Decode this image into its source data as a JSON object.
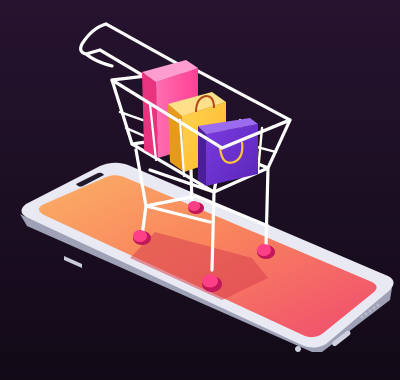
{
  "scene": {
    "subject": "shopping-cart-on-smartphone",
    "colors": {
      "background_top": "#24122e",
      "background_bottom": "#120a18",
      "screen_light": "#f9a35a",
      "screen_dark": "#f0566a",
      "phone_frame": "#e6e7f2",
      "phone_side": "#b9bccd",
      "cart_wire": "#ffffff",
      "wheels": "#e0216a",
      "pink_box": "#ff5fa8",
      "yellow_bag": "#ffc53a",
      "purple_bag": "#6a2fc8"
    },
    "icons": {
      "cart": "shopping-cart-icon",
      "phone": "smartphone-icon",
      "bags": "shopping-bag-icon"
    }
  }
}
